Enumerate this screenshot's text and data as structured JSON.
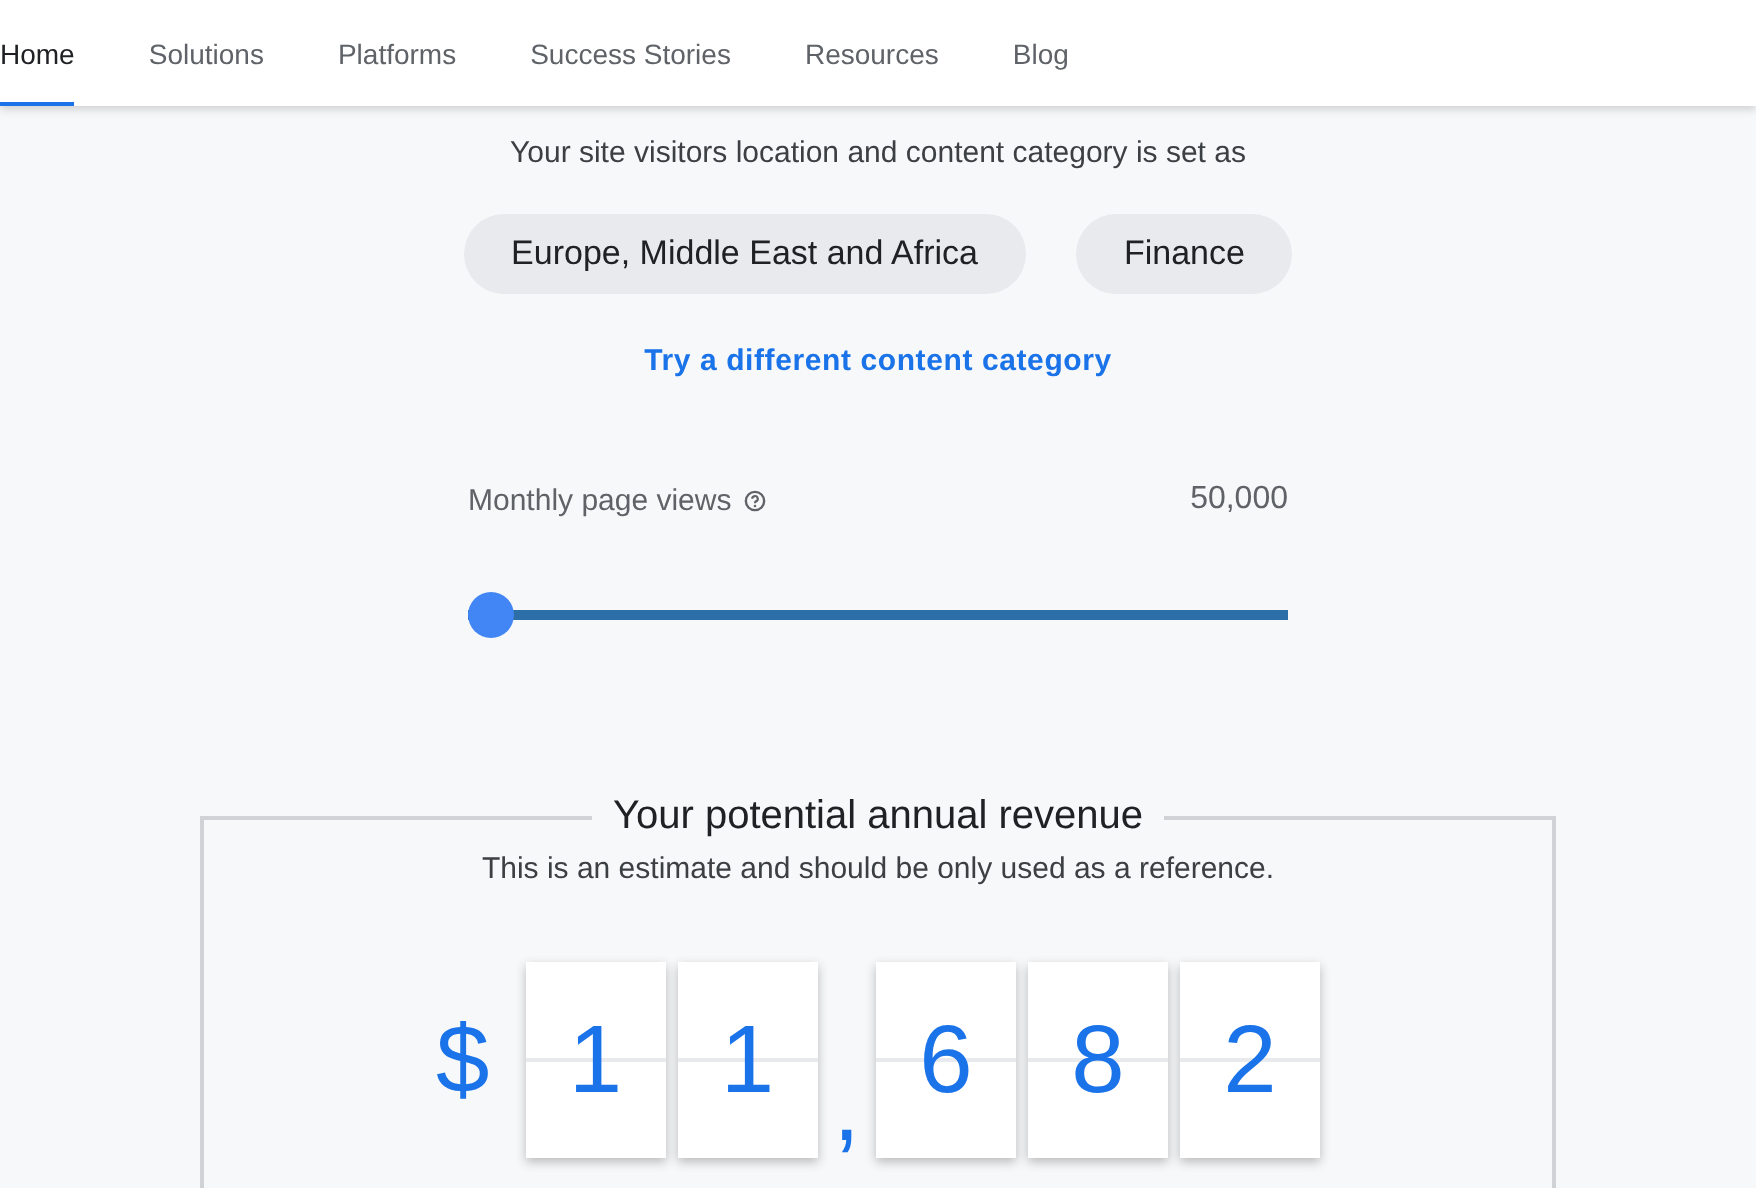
{
  "nav": {
    "items": [
      {
        "label": "Home",
        "selected": true
      },
      {
        "label": "Solutions",
        "selected": false
      },
      {
        "label": "Platforms",
        "selected": false
      },
      {
        "label": "Success Stories",
        "selected": false
      },
      {
        "label": "Resources",
        "selected": false
      },
      {
        "label": "Blog",
        "selected": false
      }
    ]
  },
  "settings": {
    "intro": "Your site visitors location and content category is set as",
    "chips": [
      "Europe, Middle East and Africa",
      "Finance"
    ],
    "link": "Try a different content category"
  },
  "page_views": {
    "label": "Monthly page views",
    "reading": "50,000",
    "level": 0
  },
  "revenue": {
    "title": "Your potential annual revenue",
    "subtitle": "This is an estimate and should be only used as a reference.",
    "currency": "$",
    "digits": [
      {
        "kind": "digit",
        "text": "1"
      },
      {
        "kind": "digit",
        "text": "1"
      },
      {
        "kind": "separator",
        "text": ","
      },
      {
        "kind": "digit",
        "text": "6"
      },
      {
        "kind": "digit",
        "text": "8"
      },
      {
        "kind": "digit",
        "text": "2"
      }
    ]
  }
}
